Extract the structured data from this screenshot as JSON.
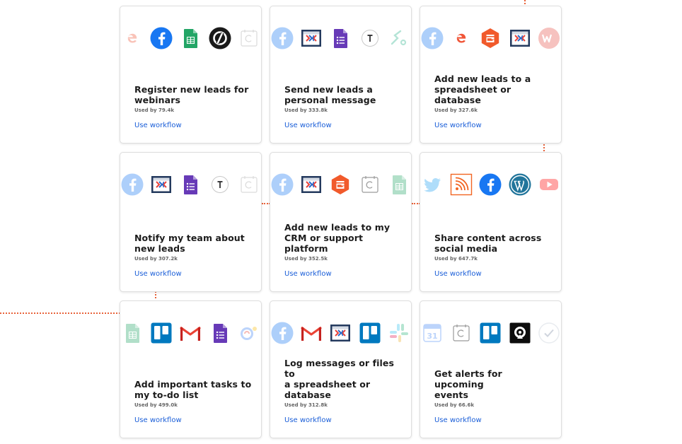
{
  "link_label": "Use workflow",
  "cards": [
    {
      "title_lines": [
        "Register new leads for",
        "webinars"
      ],
      "used": "Used by 79.4k",
      "icons": [
        "eventbrite-icon",
        "facebook-icon",
        "google-sheets-icon",
        "unbounce-icon",
        "calendar-icon"
      ]
    },
    {
      "title_lines": [
        "Send new leads a",
        "personal message"
      ],
      "used": "Used by 333.8k",
      "icons": [
        "facebook-icon",
        "clickfunnels-icon",
        "google-forms-icon",
        "typeform-icon",
        "webhook-icon"
      ]
    },
    {
      "title_lines": [
        "Add new leads to a",
        "spreadsheet or database"
      ],
      "used": "Used by 327.6k",
      "icons": [
        "facebook-icon",
        "eventbrite-icon",
        "gravity-forms-icon",
        "clickfunnels-icon",
        "webflow-icon"
      ]
    },
    {
      "title_lines": [
        "Notify my team about",
        "new leads"
      ],
      "used": "Used by 307.2k",
      "icons": [
        "facebook-icon",
        "clickfunnels-icon",
        "google-forms-icon",
        "typeform-icon",
        "calendar-icon"
      ]
    },
    {
      "title_lines": [
        "Add new leads to my",
        "CRM or support platform"
      ],
      "used": "Used by 352.5k",
      "icons": [
        "facebook-icon",
        "clickfunnels-icon",
        "gravity-forms-icon",
        "calendar-icon",
        "google-sheets-icon"
      ]
    },
    {
      "title_lines": [
        "Share content across",
        "social media"
      ],
      "used": "Used by 647.7k",
      "icons": [
        "twitter-icon",
        "rss-icon",
        "facebook-icon",
        "wordpress-icon",
        "youtube-icon"
      ]
    },
    {
      "title_lines": [
        "Add important tasks to",
        "my to-do list"
      ],
      "used": "Used by 499.0k",
      "icons": [
        "google-sheets-icon",
        "trello-icon",
        "gmail-icon",
        "google-forms-icon",
        "google-assistant-icon"
      ]
    },
    {
      "title_lines": [
        "Log messages or files to",
        "a spreadsheet or",
        "database"
      ],
      "used": "Used by 312.8k",
      "icons": [
        "facebook-icon",
        "gmail-icon",
        "clickfunnels-icon",
        "trello-icon",
        "slack-icon"
      ]
    },
    {
      "title_lines": [
        "Get alerts for upcoming",
        "events"
      ],
      "used": "Used by 66.6k",
      "icons": [
        "google-calendar-icon",
        "calendar-icon",
        "trello-icon",
        "quickbase-icon",
        "checkmark-icon"
      ]
    }
  ]
}
